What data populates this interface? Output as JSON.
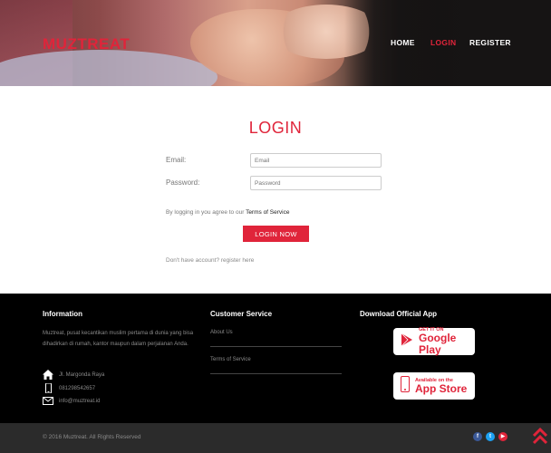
{
  "header": {
    "brand": "MUZTREAT",
    "nav": {
      "home": "HOME",
      "login": "LOGIN",
      "register": "REGISTER"
    }
  },
  "login": {
    "title": "LOGIN",
    "email_label": "Email:",
    "email_placeholder": "Email",
    "password_label": "Password:",
    "password_placeholder": "Password",
    "agree_text": "By logging in you agree to our ",
    "terms_link": "Terms of Service",
    "button": "LOGIN NOW",
    "no_account": "Don't have account? register here"
  },
  "footer": {
    "info_heading": "Information",
    "info_text": "Muztreat, pusat kecantikan muslim pertama di dunia yang bisa dihadirkan di rumah, kantor maupun dalam perjalanan Anda.",
    "address": "Jl. Margonda Raya",
    "phone": "081298542657",
    "email": "info@muztreat.id",
    "cs_heading": "Customer Service",
    "cs_links": [
      "About Us",
      "Terms of Service"
    ],
    "app_heading": "Download Official App",
    "google_play": {
      "small": "GET IT ON",
      "big": "Google Play"
    },
    "app_store": {
      "small": "Available on the",
      "big": "App Store"
    },
    "copyright": "© 2016 Muztreat. All Rights Reserved",
    "social": {
      "facebook": "f",
      "twitter": "t",
      "youtube": "▶"
    }
  },
  "colors": {
    "accent": "#e0243a",
    "footer_bg": "#000000",
    "bottom_bar": "#2b2b2b"
  }
}
